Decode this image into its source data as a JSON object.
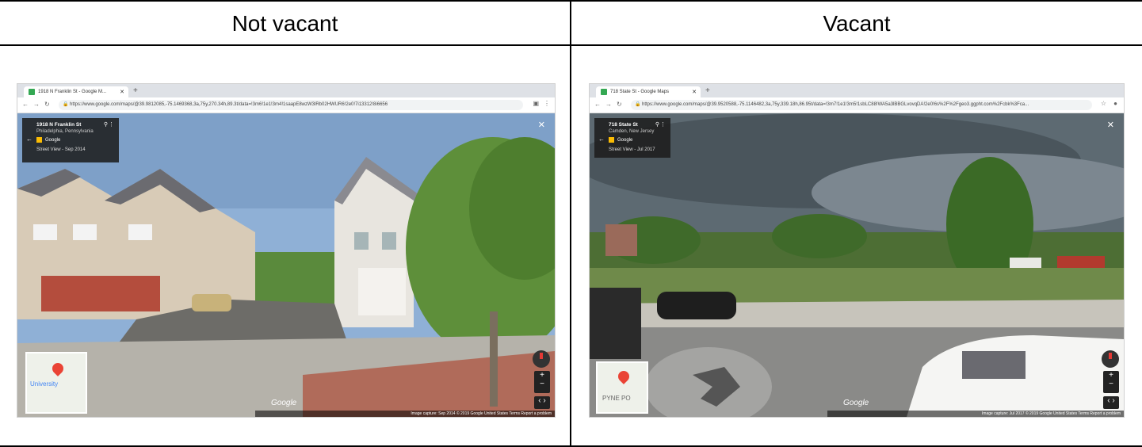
{
  "table": {
    "headers": {
      "left": "Not vacant",
      "right": "Vacant"
    }
  },
  "left_shot": {
    "tab_title": "1918 N Franklin St - Google M...",
    "url": "https://www.google.com/maps/@39.9812085,-75.1469368,3a,75y,270.34h,89.3t/data=!3m6!1e1!3m4!1saapE8wzW3lRb02HWUR6!2e0!7i13312!8i6656",
    "card_title": "1918 N Franklin St",
    "card_subtitle": "Philadelphia, Pennsylvania",
    "card_brand": "Google",
    "card_date": "Street View - Sep 2014",
    "watermark": "Google",
    "footer": "Image capture: Sep 2014   © 2019 Google   United States   Terms   Report a problem",
    "map_label": "University",
    "colors": {
      "sky": "#7ea0c8",
      "grass": "#5c8a3a",
      "house": "#d8cbb7",
      "road": "#9a9890"
    }
  },
  "right_shot": {
    "tab_title": "718 State St - Google Maps",
    "url": "https://www.google.com/maps/@39.9520588,-75.1146482,3a,75y,339.18h,86.95t/data=!3m7!1e1!3m5!1sbLC88!WA5a3lBBGLvovqDA!2e0!6s%2F%2Fgeo3.ggpht.com%2Fcbk%3Fca...",
    "card_title": "718 State St",
    "card_subtitle": "Camden, New Jersey",
    "card_brand": "Google",
    "card_date": "Street View - Jul 2017",
    "watermark": "Google",
    "footer": "Image capture: Jul 2017   © 2019 Google   United States   Terms   Report a problem",
    "map_label": "PYNE PO",
    "colors": {
      "sky": "#5d6a72",
      "grass": "#6f8a4a",
      "road": "#8a8a88"
    }
  }
}
